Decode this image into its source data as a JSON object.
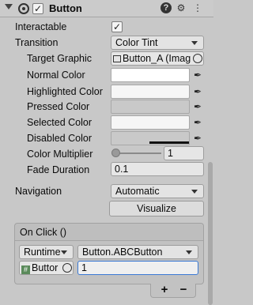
{
  "header": {
    "title": "Button",
    "enabled_check": "✓",
    "help_icon": "?",
    "settings_icon": "⚙",
    "menu_icon": "⋮"
  },
  "interactable": {
    "label": "Interactable",
    "check": "✓"
  },
  "transition": {
    "label": "Transition",
    "value": "Color Tint"
  },
  "target_graphic": {
    "label": "Target Graphic",
    "value": "Button_A (Imag"
  },
  "colors": [
    {
      "label": "Normal Color",
      "value": "#ffffff"
    },
    {
      "label": "Highlighted Color",
      "value": "#f5f5f5"
    },
    {
      "label": "Pressed Color",
      "value": "#c8c8c8"
    },
    {
      "label": "Selected Color",
      "value": "#f5f5f5"
    },
    {
      "label": "Disabled Color",
      "value": "#c8c8c8"
    }
  ],
  "color_multiplier": {
    "label": "Color Multiplier",
    "value": "1"
  },
  "fade_duration": {
    "label": "Fade Duration",
    "value": "0.1"
  },
  "navigation": {
    "label": "Navigation",
    "value": "Automatic",
    "visualize": "Visualize"
  },
  "onclick": {
    "title": "On Click ()",
    "runtime": "Runtime",
    "function": "Button.ABCButton",
    "object": "Buttor",
    "argument": "1",
    "add": "+",
    "remove": "−"
  }
}
